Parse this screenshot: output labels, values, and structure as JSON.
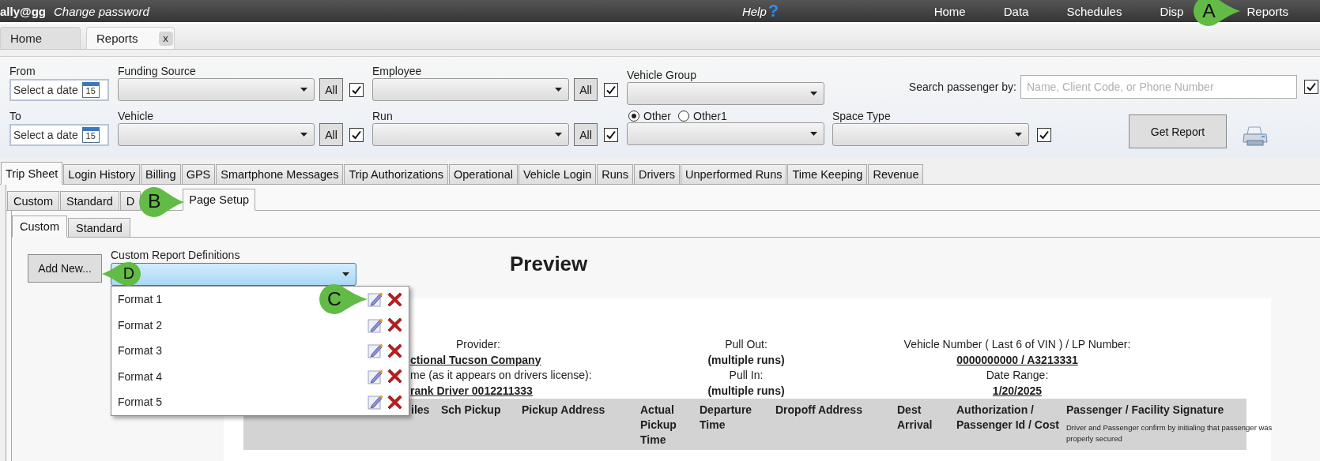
{
  "top_bar": {
    "user": "ally@gg",
    "change_password": "Change password",
    "help": "Help",
    "help_icon": "?",
    "nav": [
      {
        "label": "Home"
      },
      {
        "label": "Data"
      },
      {
        "label": "Schedules"
      },
      {
        "label": "Disp"
      },
      {
        "label": "Reports",
        "callout": "A"
      }
    ]
  },
  "doc_tabs": [
    {
      "label": "Home",
      "selected": false
    },
    {
      "label": "Reports",
      "selected": true,
      "close": "x"
    }
  ],
  "filters": {
    "from": {
      "label": "From",
      "placeholder": "Select a date",
      "calendar": "15"
    },
    "to": {
      "label": "To",
      "placeholder": "Select a date",
      "calendar": "15"
    },
    "funding_source": {
      "label": "Funding Source",
      "all": "All",
      "checked": true
    },
    "employee": {
      "label": "Employee",
      "all": "All",
      "checked": true
    },
    "vehicle_group": {
      "label": "Vehicle Group"
    },
    "vehicle": {
      "label": "Vehicle",
      "all": "All",
      "checked": true
    },
    "run": {
      "label": "Run",
      "all": "All",
      "checked": true
    },
    "group_options": [
      {
        "label": "Other",
        "selected": true
      },
      {
        "label": "Other1",
        "selected": false
      }
    ],
    "space_type": {
      "label": "Space Type",
      "checked": true
    },
    "search": {
      "label": "Search passenger by:",
      "placeholder": "Name, Client Code, or Phone Number",
      "checked": true
    },
    "get_report": "Get Report"
  },
  "report_tabs": [
    {
      "label": "Trip Sheet",
      "selected": true
    },
    {
      "label": "Login History",
      "selected": false
    },
    {
      "label": "Billing",
      "selected": false
    },
    {
      "label": "GPS",
      "selected": false
    },
    {
      "label": "Smartphone Messages",
      "selected": false
    },
    {
      "label": "Trip Authorizations",
      "selected": false
    },
    {
      "label": "Operational",
      "selected": false
    },
    {
      "label": "Vehicle Login",
      "selected": false
    },
    {
      "label": "Runs",
      "selected": false
    },
    {
      "label": "Drivers",
      "selected": false
    },
    {
      "label": "Unperformed Runs",
      "selected": false
    },
    {
      "label": "Time Keeping",
      "selected": false
    },
    {
      "label": "Revenue",
      "selected": false
    }
  ],
  "sub_tabs": [
    {
      "label": "Custom",
      "selected": false
    },
    {
      "label": "Standard",
      "selected": false
    },
    {
      "label": "D",
      "selected": false
    },
    {
      "label": "Page Setup",
      "selected": true,
      "callout": "B"
    }
  ],
  "page_setup_tabs": [
    {
      "label": "Custom",
      "selected": true
    },
    {
      "label": "Standard",
      "selected": false
    }
  ],
  "add_new": {
    "label": "Add New...",
    "callout": "D"
  },
  "definitions": {
    "label": "Custom Report Definitions",
    "expanded": true,
    "options": [
      {
        "label": "Format 1",
        "callout": "C"
      },
      {
        "label": "Format 2"
      },
      {
        "label": "Format 3"
      },
      {
        "label": "Format 4"
      },
      {
        "label": "Format 5"
      }
    ]
  },
  "preview": {
    "title": "Preview",
    "info_columns": [
      [
        {
          "text": "Provider:",
          "kind": "label"
        },
        {
          "text": "ctional Tucson Company",
          "kind": "link_value"
        },
        {
          "text": "me (as it appears on drivers license):",
          "kind": "label"
        },
        {
          "text": "rank Driver 0012211333",
          "kind": "link_value"
        }
      ],
      [
        {
          "text": "Pull Out:",
          "kind": "label"
        },
        {
          "text": "(multiple runs)",
          "kind": "value"
        },
        {
          "text": "Pull In:",
          "kind": "label"
        },
        {
          "text": "(multiple runs)",
          "kind": "value"
        }
      ],
      [
        {
          "text": "Vehicle Number ( Last 6 of VIN ) / LP Number:",
          "kind": "label"
        },
        {
          "text": "0000000000 / A3213331",
          "kind": "link_value"
        },
        {
          "text": "Date Range:",
          "kind": "label"
        },
        {
          "text": "1/20/2025",
          "kind": "link_value"
        }
      ]
    ],
    "table_headers": [
      {
        "label": "iles"
      },
      {
        "label": "Sch Pickup"
      },
      {
        "label": "Pickup Address"
      },
      {
        "label": "Actual Pickup Time"
      },
      {
        "label": "Departure Time"
      },
      {
        "label": "Dropoff Address"
      },
      {
        "label": "Dest Arrival"
      },
      {
        "label": "Authorization / Passenger Id / Cost"
      },
      {
        "label": "Passenger / Facility Signature",
        "note": "Driver and Passenger confirm by initialing that passenger was properly secured"
      }
    ]
  }
}
